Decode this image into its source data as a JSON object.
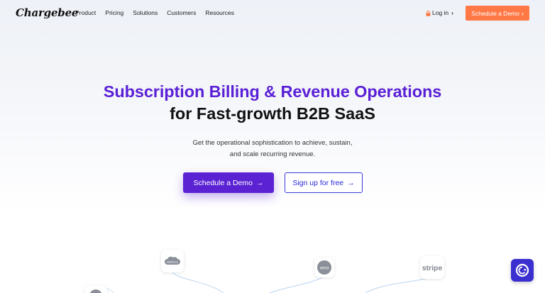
{
  "brand": {
    "name": "Chargebee"
  },
  "nav": {
    "items": [
      "Product",
      "Pricing",
      "Solutions",
      "Customers",
      "Resources"
    ],
    "login": "Log in",
    "login_chevron": "›",
    "demo": "Schedule a Demo",
    "demo_chevron": "›"
  },
  "hero": {
    "title_line1": "Subscription Billing & Revenue Operations",
    "title_line2": "for Fast-growth B2B SaaS",
    "subtitle_line1": "Get the operational sophistication to achieve, sustain,",
    "subtitle_line2": "and scale recurring revenue.",
    "primary_cta": "Schedule a Demo",
    "primary_arrow": "→",
    "secondary_cta": "Sign up for free",
    "secondary_arrow": "→"
  },
  "integrations": {
    "logos": [
      "salesforce",
      "xero",
      "stripe"
    ]
  },
  "colors": {
    "brand_purple": "#5b22d3",
    "title_purple": "#5a1fd6",
    "accent_orange": "#ff7846",
    "link_blue": "#2a2ad8"
  }
}
